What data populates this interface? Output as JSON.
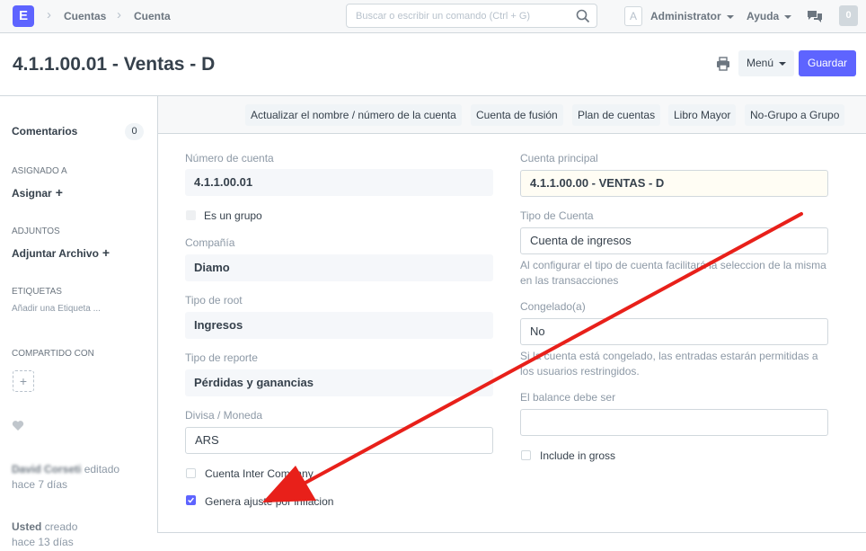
{
  "navbar": {
    "logo": "E",
    "breadcrumbs": [
      "Cuentas",
      "Cuenta"
    ],
    "search_placeholder": "Buscar o escribir un comando (Ctrl + G)",
    "avatar_letter": "A",
    "user": "Administrator",
    "help": "Ayuda",
    "notifications": "0"
  },
  "page": {
    "title": "4.1.1.00.01 - Ventas - D",
    "menu_label": "Menú",
    "save_label": "Guardar"
  },
  "sidebar": {
    "comments_label": "Comentarios",
    "comments_count": "0",
    "assigned_header": "ASIGNADO A",
    "assign_label": "Asignar",
    "attachments_header": "ADJUNTOS",
    "attach_label": "Adjuntar Archivo",
    "tags_header": "ETIQUETAS",
    "add_tag": "Añadir una Etiqueta ...",
    "shared_header": "COMPARTIDO CON",
    "activity": [
      {
        "user": "David Corseti",
        "action": "editado",
        "time": "hace 7 días"
      },
      {
        "user": "Usted",
        "action": "creado",
        "time": "hace 13 días"
      }
    ]
  },
  "toolbar": {
    "buttons": [
      "Actualizar el nombre / número de la cuenta",
      "Cuenta de fusión",
      "Plan de cuentas",
      "Libro Mayor",
      "No-Grupo a Grupo"
    ]
  },
  "form": {
    "left": {
      "account_number_label": "Número de cuenta",
      "account_number": "4.1.1.00.01",
      "is_group_label": "Es un grupo",
      "company_label": "Compañía",
      "company": "Diamo",
      "root_type_label": "Tipo de root",
      "root_type": "Ingresos",
      "report_type_label": "Tipo de reporte",
      "report_type": "Pérdidas y ganancias",
      "currency_label": "Divisa / Moneda",
      "currency": "ARS",
      "inter_company_label": "Cuenta Inter Company",
      "inflation_label": "Genera ajuste por inflacion",
      "inflation_checked": true
    },
    "right": {
      "parent_label": "Cuenta principal",
      "parent": "4.1.1.00.00 - VENTAS - D",
      "account_type_label": "Tipo de Cuenta",
      "account_type": "Cuenta de ingresos",
      "account_type_help": "Al configurar el tipo de cuenta facilitará la seleccion de la misma en las transacciones",
      "frozen_label": "Congelado(a)",
      "frozen": "No",
      "frozen_help": "Si la cuenta está congelado, las entradas estarán permitidas a los usuarios restringidos.",
      "balance_label": "El balance debe ser",
      "balance": "",
      "include_gross_label": "Include in gross"
    }
  },
  "colors": {
    "accent": "#5e64ff",
    "annotation_arrow": "#e8201a"
  }
}
